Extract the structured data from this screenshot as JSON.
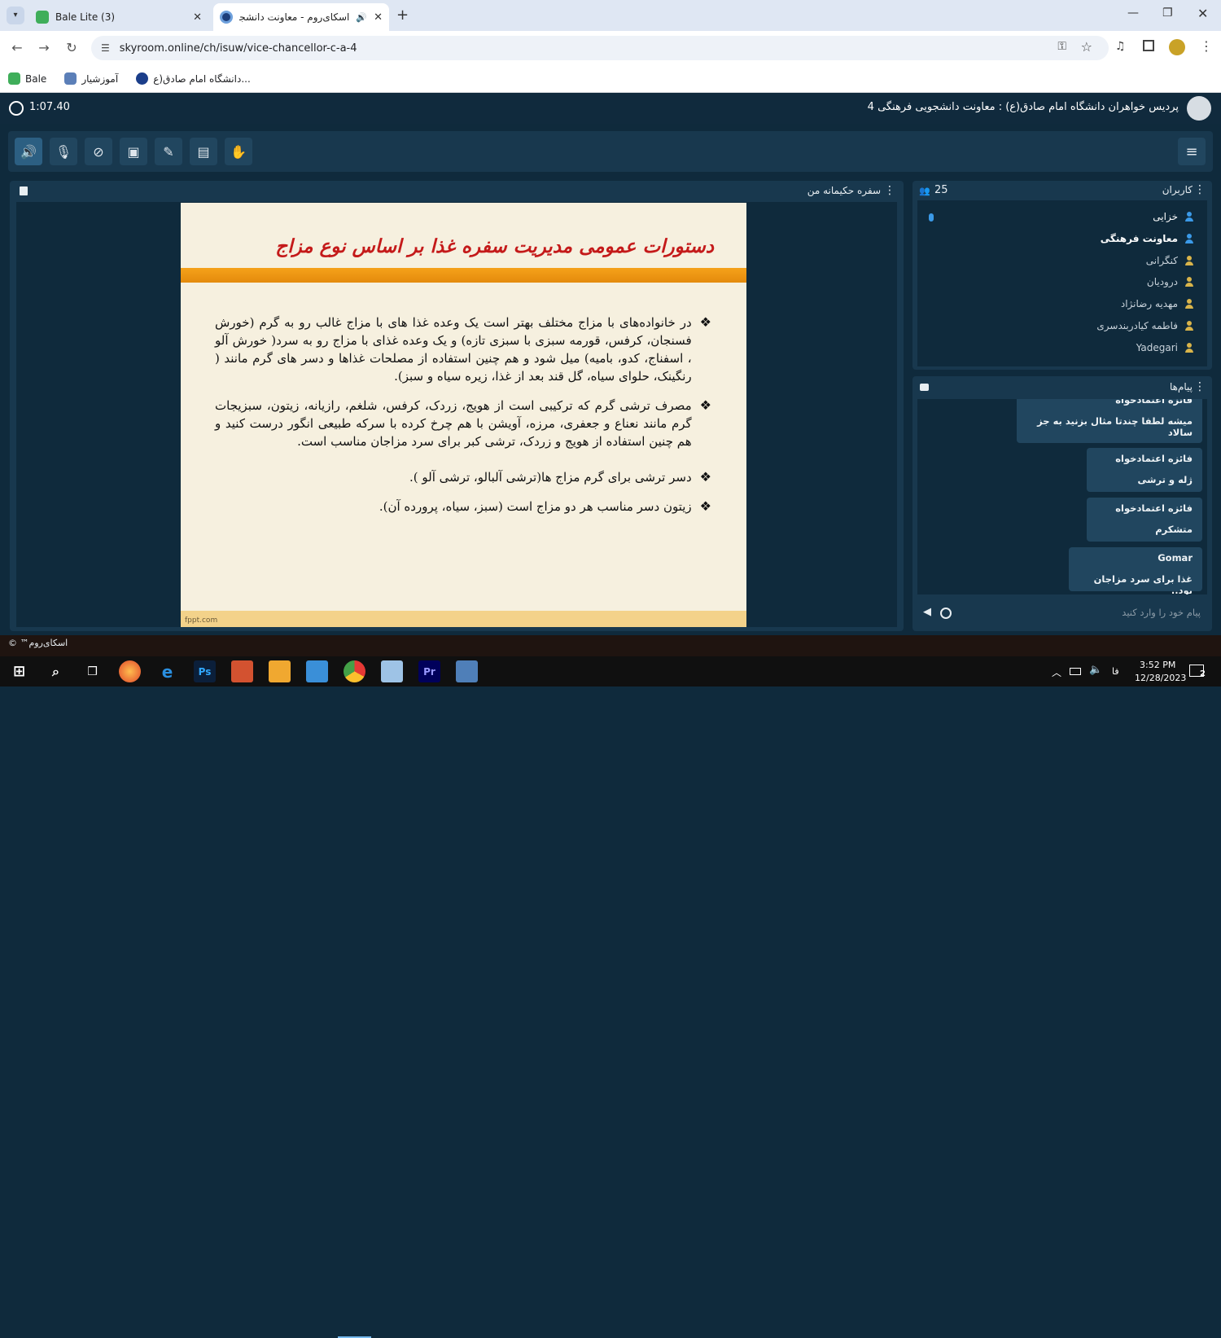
{
  "browser": {
    "tabs": [
      {
        "title": "Bale Lite (3)",
        "icon": "bale-icon"
      },
      {
        "title": "اسکای‌روم - معاونت دانشجو...",
        "icon": "skyroom-icon",
        "audio": true
      }
    ],
    "url": "skyroom.online/ch/isuw/vice-chancellor-c-a-4",
    "bookmarks": [
      "Bale",
      "آموزشیار",
      "دانشگاه امام صادق(ع..."
    ]
  },
  "room": {
    "title": "پردیس خواهران دانشگاه امام صادق(ع) : معاونت دانشجویی فرهنگی 4",
    "timer": "1:07.40",
    "footer": "اسکای‌روم™ ©"
  },
  "whiteboard": {
    "title": "سفره حکیمانه من",
    "slide": {
      "heading": "دستورات عمومی مدیریت سفره غذا بر اساس نوع مزاج",
      "bullets": [
        "در خانواده‌های با مزاج مختلف بهتر است یک وعده غذا های با مزاج غالب رو به گرم (خورش فسنجان، کرفس، قورمه سبزی با سبزی تازه) و یک وعده غذای با مزاج رو به سرد( خورش آلو ، اسفناج، کدو، بامیه) میل شود و هم چنین استفاده از مصلحات غذاها و دسر های گرم مانند ( رنگینک، حلوای سیاه، گل قند بعد از غذا، زیره سیاه و سبز).",
        "مصرف ترشی گرم که ترکیبی است از هویج، زردک، کرفس، شلغم، رازیانه، زیتون، سبزیجات گرم مانند نعناع و جعفری، مرزه، آویشن  با هم چرخ کرده با سرکه طبیعی انگور درست کنید و هم چنین استفاده از هویج و زردک، ترشی کبر برای سرد مزاجان مناسب است.",
        "دسر ترشی برای گرم مزاج ها(ترشی آلبالو، ترشی آلو ).",
        "زیتون دسر مناسب هر دو مزاج است (سبز، سیاه، پرورده آن)."
      ],
      "footer": "fppt.com"
    }
  },
  "users": {
    "title": "کاربران",
    "count": "25",
    "list": [
      {
        "name": "خزایی",
        "bold": false
      },
      {
        "name": "معاونت فرهنگی",
        "bold": true
      },
      {
        "name": "کنگرانی",
        "bold": false
      },
      {
        "name": "درودیان",
        "bold": false
      },
      {
        "name": "مهدیه رضانژاد",
        "bold": false
      },
      {
        "name": "فاطمه کیادربندسری",
        "bold": false
      },
      {
        "name": "Yadegari",
        "bold": false
      }
    ]
  },
  "chat": {
    "title": "پیام‌ها",
    "messages": [
      {
        "sender": "فائزه اعتمادخواه",
        "text": "میشه لطفا چندتا مثال بزنید به جز سالاد"
      },
      {
        "sender": "فائزه اعتمادخواه",
        "text": "ژله و ترشی"
      },
      {
        "sender": "فائزه اعتمادخواه",
        "text": "متشکرم"
      },
      {
        "sender": "Gomar",
        "text": "غذا برای سرد مزاجان بود.."
      }
    ],
    "placeholder": "پیام خود را وارد کنید"
  },
  "taskbar": {
    "lang": "فا",
    "time": "3:52 PM",
    "date": "12/28/2023",
    "notifications": "2"
  }
}
